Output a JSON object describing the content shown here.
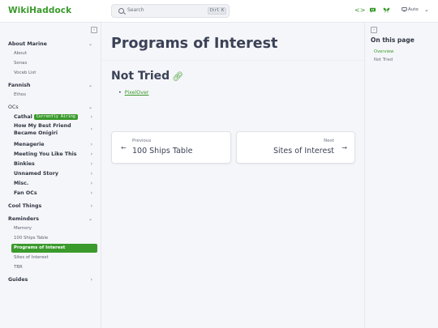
{
  "header": {
    "logo": "WikiHaddock",
    "search_placeholder": "Search",
    "search_shortcut": "Ctrl K",
    "theme_label": "Auto"
  },
  "sidebar": {
    "sections": [
      {
        "label": "About Marine",
        "children": [
          "About",
          "Sonas",
          "Vocab List"
        ]
      },
      {
        "label": "Fannish",
        "children": [
          "Ethos"
        ]
      },
      {
        "label": "OCs",
        "children": []
      },
      {
        "label": "Cool Things",
        "children": []
      },
      {
        "label": "Reminders",
        "children": [
          "Memory",
          "100 Ships Table",
          "Programs of Interest",
          "Sites of Interest",
          "TBR"
        ]
      },
      {
        "label": "Guides",
        "children": []
      }
    ],
    "oc_items": [
      {
        "label": "Cathal",
        "badge": "Currently Airing"
      },
      {
        "label": "How My Best Friend Became Onigiri"
      },
      {
        "label": "Menagerie"
      },
      {
        "label": "Meeting You Like This"
      },
      {
        "label": "Binkies"
      },
      {
        "label": "Unnamed Story"
      },
      {
        "label": "Misc."
      },
      {
        "label": "Fan OCs"
      }
    ]
  },
  "main": {
    "page_title": "Programs of Interest",
    "section_title": "Not Tried",
    "bullet_link": "PixelOver",
    "prev": {
      "small": "Previous",
      "big": "100 Ships Table"
    },
    "next": {
      "small": "Next",
      "big": "Sites of Interest"
    }
  },
  "toc": {
    "title": "On this page",
    "items": [
      "Overview",
      "Not Tried"
    ]
  },
  "colors": {
    "accent": "#3a9a2c",
    "heading": "#3b4257",
    "background": "#f5f6f9"
  }
}
